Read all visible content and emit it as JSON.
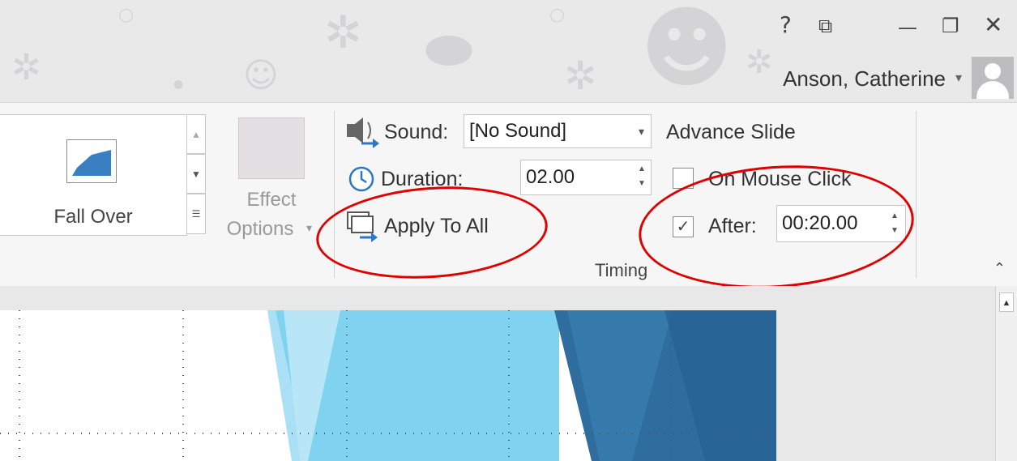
{
  "window": {
    "help_glyph": "?",
    "restore_ribbon_glyph": "⧉",
    "minimize_glyph": "—",
    "maximize_glyph": "❐",
    "close_glyph": "✕"
  },
  "user": {
    "name": "Anson, Catherine",
    "caret": "▾",
    "avatar_icon": "person-icon"
  },
  "ribbon": {
    "gallery": {
      "selected_label": "Fall Over",
      "up": "▲",
      "down": "▼",
      "more": "☰"
    },
    "effect_options": {
      "line1": "Effect",
      "line2": "Options",
      "caret": "▾"
    },
    "timing": {
      "sound_label": "Sound:",
      "sound_value": "[No Sound]",
      "sound_caret": "▾",
      "duration_label": "Duration:",
      "duration_value": "02.00",
      "apply_all_label": "Apply To All",
      "advance_title": "Advance Slide",
      "on_mouse_click_label": "On Mouse Click",
      "on_mouse_click_checked": false,
      "after_label": "After:",
      "after_checked": true,
      "after_value": "00:20.00",
      "check_glyph": "✓",
      "spin_up": "▲",
      "spin_down": "▼",
      "group_title": "Timing"
    },
    "collapse_glyph": "⌃"
  },
  "annotations": {
    "color": "#e00000"
  },
  "slide": {
    "accent_light": "#7fd3f0",
    "accent_mid": "#4ab8e4",
    "accent_dark": "#2e6d9e"
  }
}
